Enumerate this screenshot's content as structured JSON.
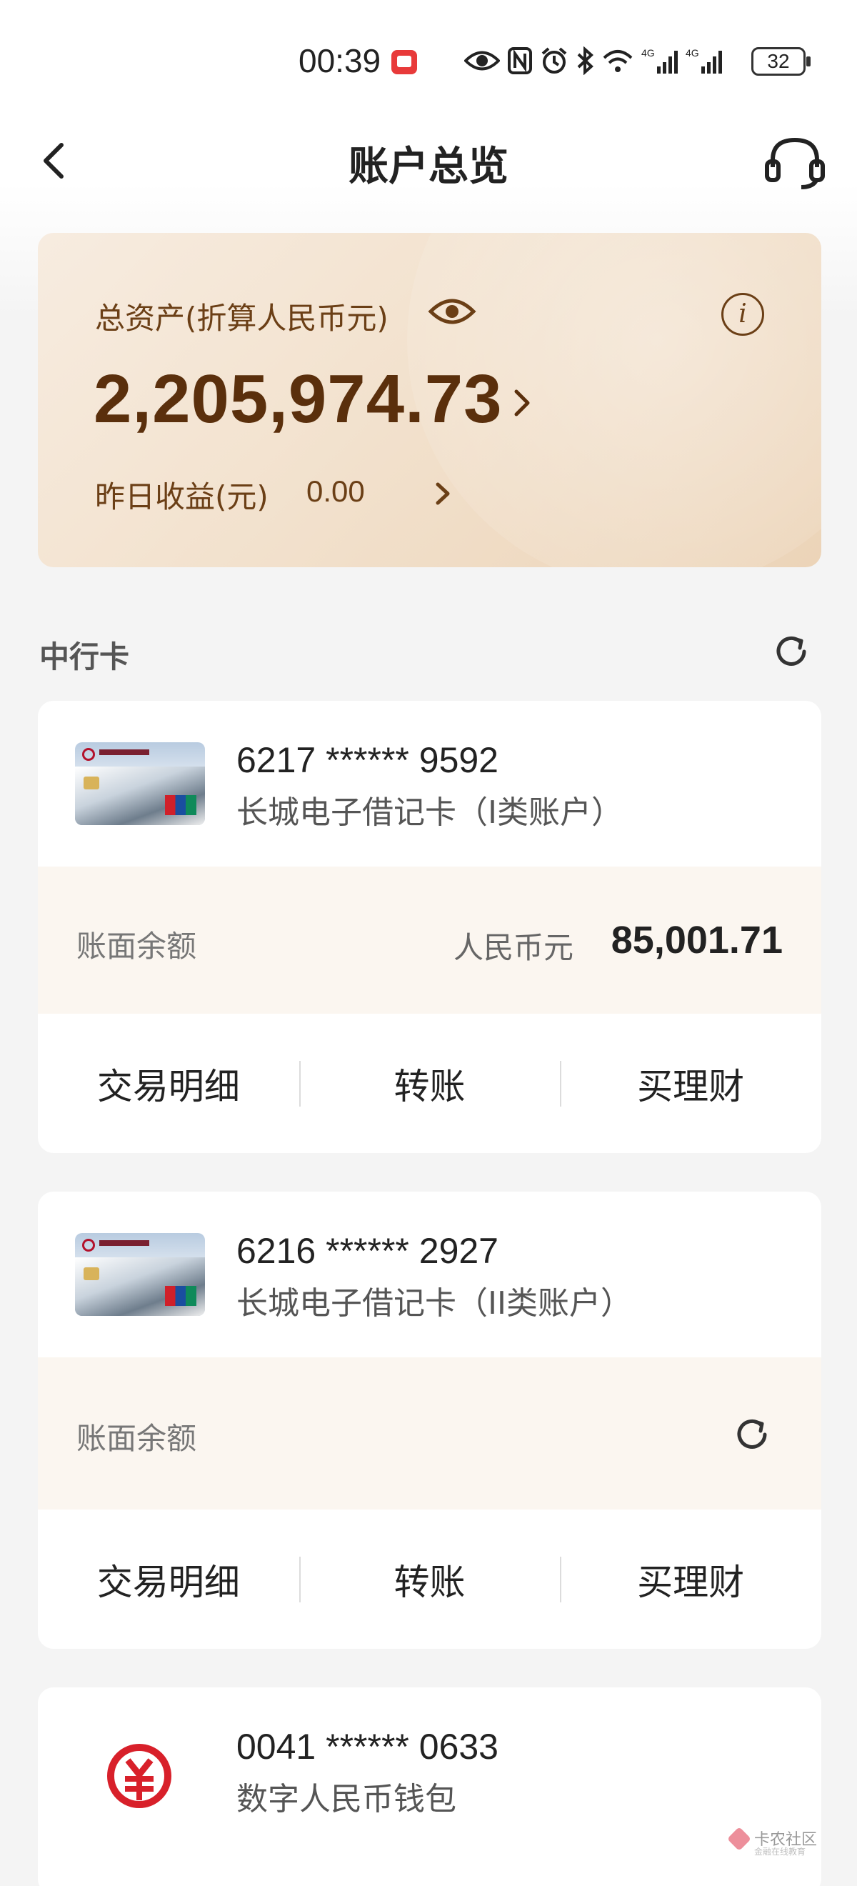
{
  "status_bar": {
    "time": "00:39",
    "battery": "32",
    "icons": [
      "eye-icon",
      "nfc-icon",
      "alarm-icon",
      "bluetooth-icon",
      "wifi-icon",
      "signal-4g-icon",
      "signal-4g-icon"
    ]
  },
  "header": {
    "title": "账户总览"
  },
  "asset_card": {
    "label": "总资产(折算人民币元)",
    "total": "2,205,974.73",
    "yesterday_label": "昨日收益(元)",
    "yesterday_value": "0.00"
  },
  "section": {
    "title": "中行卡"
  },
  "cards": [
    {
      "number": "6217 ****** 9592",
      "type": "长城电子借记卡（I类账户）",
      "balance_label": "账面余额",
      "currency": "人民币元",
      "amount": "85,001.71",
      "actions": [
        "交易明细",
        "转账",
        "买理财"
      ]
    },
    {
      "number": "6216 ****** 2927",
      "type": "长城电子借记卡（II类账户）",
      "balance_label": "账面余额",
      "actions": [
        "交易明细",
        "转账",
        "买理财"
      ]
    },
    {
      "number": "0041 ****** 0633",
      "type": "数字人民币钱包"
    }
  ],
  "watermark": {
    "text": "卡农社区",
    "sub": "金融在线教育"
  },
  "colors": {
    "asset_text": "#6b3f16",
    "asset_value": "#5a2f0c",
    "ecny_red": "#d8202a"
  }
}
